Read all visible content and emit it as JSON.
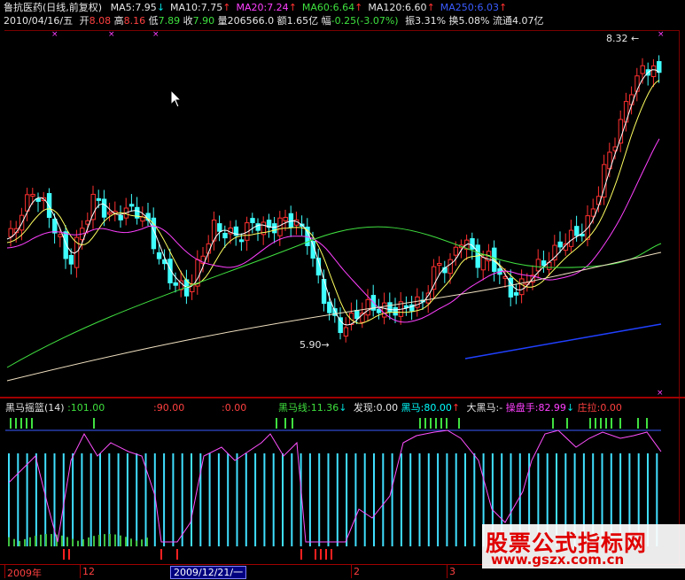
{
  "header": {
    "stock_name": "鲁抗医药(日线,前复权)",
    "ma": [
      {
        "label": "MA5:7.95",
        "color": "#e6e6e6",
        "dir": "↓"
      },
      {
        "label": "MA10:7.75",
        "color": "#e6e6e6",
        "dir": "↑"
      },
      {
        "label": "MA20:7.24",
        "color": "#ff40ff",
        "dir": "↑"
      },
      {
        "label": "MA60:6.64",
        "color": "#3ee03e",
        "dir": "↑"
      },
      {
        "label": "MA120:6.60",
        "color": "#e6e6e6",
        "dir": "↑"
      },
      {
        "label": "MA250:6.03",
        "color": "#3a5cff",
        "dir": "↑"
      }
    ]
  },
  "quote": {
    "date": "2010/04/16/五",
    "open_label": "开",
    "open": "8.08",
    "high_label": "高",
    "high": "8.16",
    "low_label": "低",
    "low": "7.89",
    "close_label": "收",
    "close": "7.90",
    "volume_label": "量",
    "volume": "206566.0",
    "amount_label": "额",
    "amount": "1.65亿",
    "change_label": "幅",
    "change": "-0.25(-3.07%)",
    "amplitude_label": "振",
    "amplitude": "3.31%",
    "turnover_label": "换",
    "turnover": "5.08%",
    "float_label": "流通",
    "float": "4.07亿"
  },
  "price_marks": {
    "high_mark": "8.32",
    "low_mark": "5.90"
  },
  "indicator": {
    "name": "黑马摇篮(14)",
    "v1": ":101.00",
    "v2": ":90.00",
    "v3": ":0.00",
    "line_label": "黑马线:11.36",
    "line_dir": "↓",
    "discover": "发现:0.00",
    "heima": "黑马:80.00",
    "heima_dir": "↑",
    "big_heima": "大黑马:-",
    "operator": "操盘手:82.99",
    "operator_dir": "↓",
    "pull_up": "庄拉:0.00"
  },
  "axis": {
    "ticks": [
      "2009年",
      "12",
      "2",
      "3"
    ],
    "cursor_date": "2009/12/21/一"
  },
  "watermark": {
    "title": "股票公式指标网",
    "url": "www.gszx.com.cn"
  },
  "colors": {
    "up": "#ff3030",
    "down": "#40ffff",
    "ma5": "#ffffff",
    "ma10": "#ffff60",
    "ma20": "#ff40ff",
    "ma60": "#40e040",
    "ma120": "#f0e0c0",
    "ma250": "#2040ff"
  }
}
